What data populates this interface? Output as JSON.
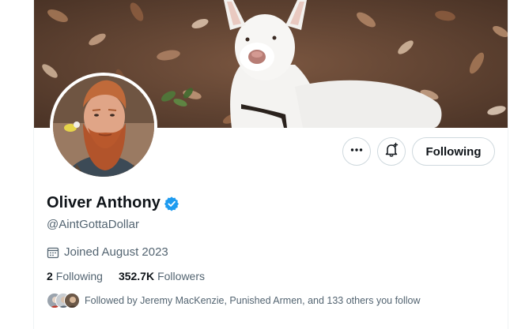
{
  "profile": {
    "display_name": "Oliver Anthony",
    "handle": "@AintGottaDollar",
    "joined": "Joined August 2023",
    "verified": true
  },
  "actions": {
    "more_icon": "more-horizontal-icon",
    "notify_icon": "bell-add-icon",
    "follow_label": "Following"
  },
  "stats": {
    "following_count": "2",
    "following_label": "Following",
    "followers_count": "352.7K",
    "followers_label": "Followers"
  },
  "followed_by": {
    "text": "Followed by Jeremy MacKenzie, Punished Armen, and 133 others you follow"
  },
  "colors": {
    "text_primary": "#0f1419",
    "text_secondary": "#536471",
    "verified_blue": "#1d9bf0",
    "border": "#cfd9de"
  }
}
